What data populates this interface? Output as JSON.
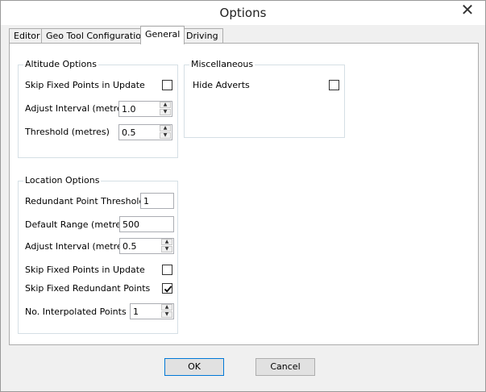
{
  "window": {
    "title": "Options",
    "close_glyph": "✕"
  },
  "tabs": [
    {
      "label": "Editor",
      "active": false
    },
    {
      "label": "Geo Tool Configuration",
      "active": false
    },
    {
      "label": "General",
      "active": true
    },
    {
      "label": "Driving",
      "active": false
    }
  ],
  "altitude": {
    "title": "Altitude Options",
    "skip_fixed_label": "Skip Fixed Points in Update",
    "skip_fixed_checked": false,
    "adjust_interval_label": "Adjust Interval (metres)",
    "adjust_interval_value": "1.0",
    "threshold_label": "Threshold (metres)",
    "threshold_value": "0.5"
  },
  "misc": {
    "title": "Miscellaneous",
    "hide_adverts_label": "Hide Adverts",
    "hide_adverts_checked": false
  },
  "location": {
    "title": "Location Options",
    "redundant_threshold_label": "Redundant Point Threshold",
    "redundant_threshold_value": "1",
    "default_range_label": "Default Range (metres)",
    "default_range_value": "500",
    "adjust_interval_label": "Adjust Interval (metres)",
    "adjust_interval_value": "0.5",
    "skip_fixed_label": "Skip Fixed Points in Update",
    "skip_fixed_checked": false,
    "skip_redundant_label": "Skip Fixed Redundant Points",
    "skip_redundant_checked": true,
    "interpolated_label": "No. Interpolated Points",
    "interpolated_value": "1"
  },
  "buttons": {
    "ok": "OK",
    "cancel": "Cancel"
  },
  "icons": {
    "spin_up": "▲",
    "spin_down": "▼"
  }
}
